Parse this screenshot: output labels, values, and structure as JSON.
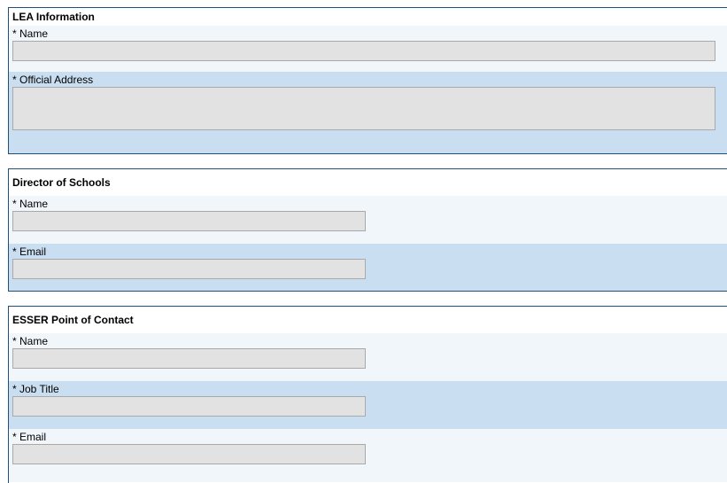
{
  "lea": {
    "title": "LEA Information",
    "name_label": "* Name",
    "name_value": "",
    "address_label": "* Official Address",
    "address_value": ""
  },
  "director": {
    "title": "Director of Schools",
    "name_label": "* Name",
    "name_value": "",
    "email_label": "* Email",
    "email_value": ""
  },
  "esser": {
    "title": "ESSER Point of Contact",
    "name_label": "* Name",
    "name_value": "",
    "job_title_label": "* Job Title",
    "job_title_value": "",
    "email_label": "* Email",
    "email_value": ""
  },
  "colors": {
    "panel_border": "#1e4f7d",
    "row_light": "#f1f6fb",
    "row_dark": "#c9def0",
    "field_background": "#e2e2e2"
  }
}
